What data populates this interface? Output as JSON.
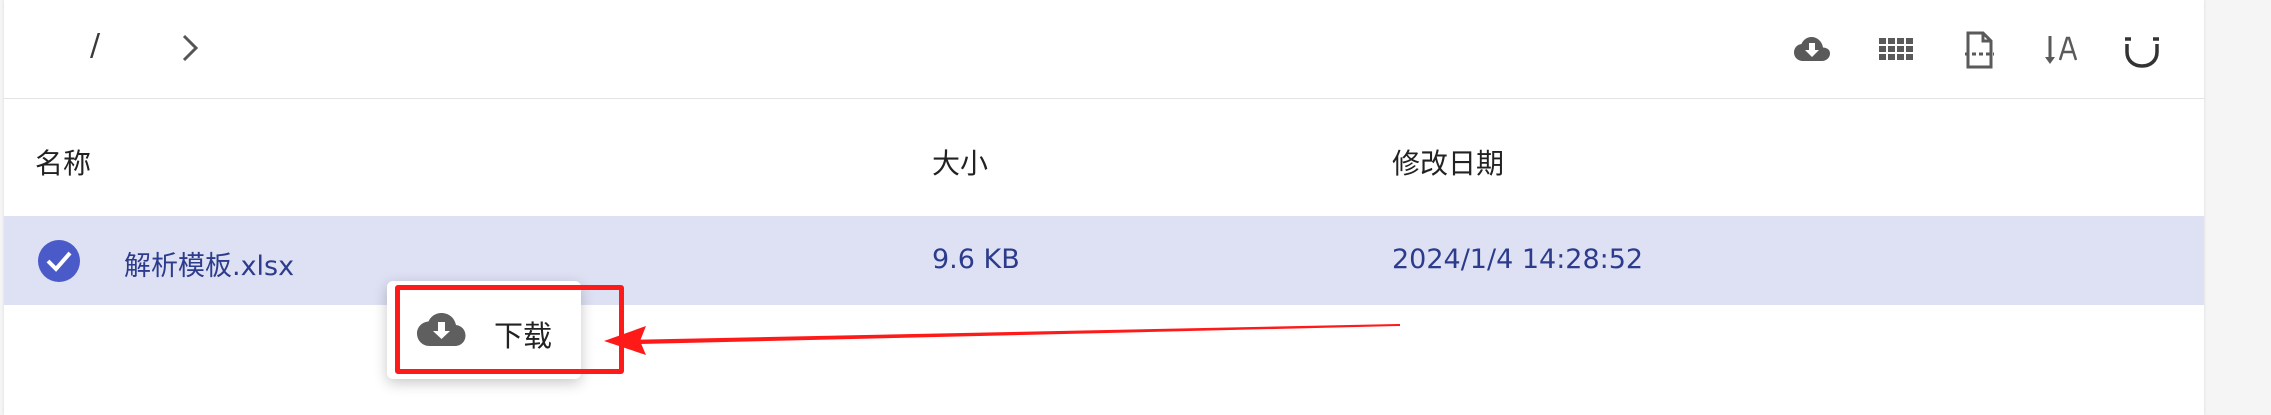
{
  "toolbar": {
    "breadcrumb_root": "/",
    "icons": [
      "cloud-download-icon",
      "grid-view-icon",
      "file-info-icon",
      "sort-alpha-icon",
      "select-icon"
    ]
  },
  "table": {
    "columns": [
      "名称",
      "大小",
      "修改日期"
    ],
    "rows": [
      {
        "name": "解析模板.xlsx",
        "size": "9.6 KB",
        "modified": "2024/1/4 14:28:52",
        "selected": true
      }
    ]
  },
  "context_menu": {
    "items": [
      {
        "label": "下载",
        "icon": "cloud-download-icon"
      }
    ]
  },
  "colors": {
    "selection_bg": "#dde1f3",
    "accent": "#4a5ac8",
    "row_text": "#2d3b8c",
    "annotation_red": "#ff1a1a"
  }
}
